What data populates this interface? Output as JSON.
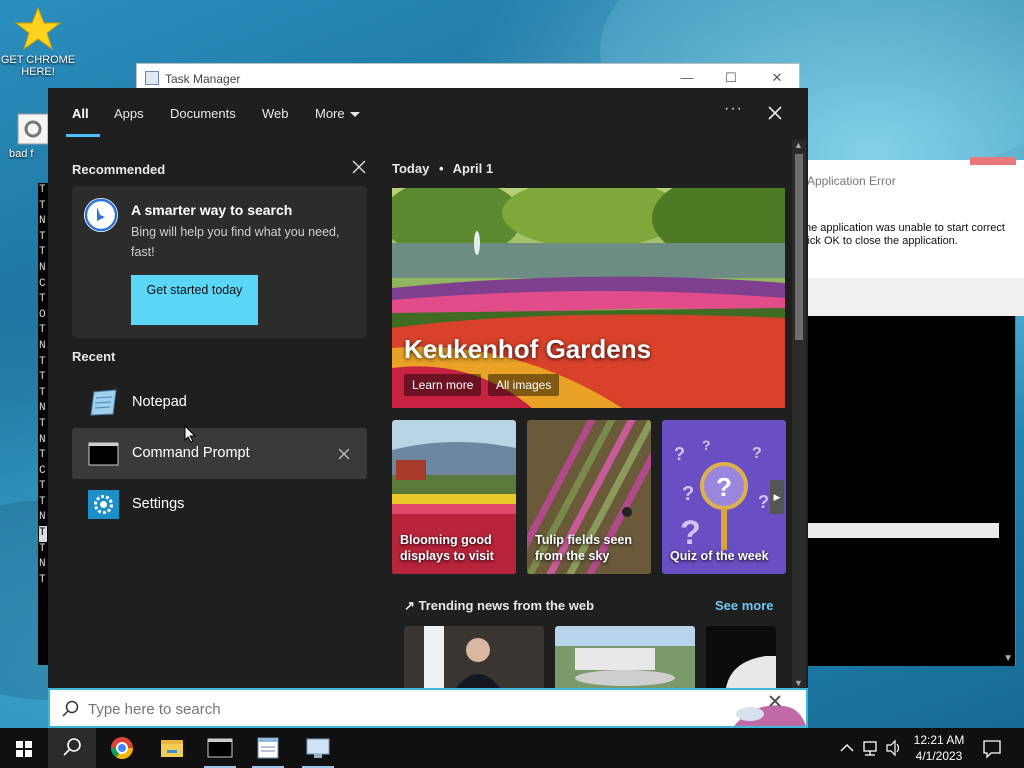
{
  "desktop": {
    "icons": [
      {
        "label": "GET CHROME HERE!",
        "icon": "star-icon"
      },
      {
        "label": "bad f",
        "icon": "settings-file-icon"
      }
    ]
  },
  "task_manager": {
    "title": "Task Manager",
    "controls": {
      "minimize": "—",
      "maximize": "☐",
      "close": "✕"
    }
  },
  "console_left": {
    "lines": [
      "T",
      "T",
      "N",
      "T",
      "T",
      "N",
      "C",
      "T",
      "O",
      "T",
      "N",
      "T",
      "T",
      "T",
      "N",
      "T",
      "N",
      "T",
      "C",
      "T",
      "T",
      "N",
      "T",
      "T",
      "N",
      "T"
    ]
  },
  "app_error": {
    "title": "Application Error",
    "message_line1": "he application was unable to start correct",
    "message_line2": "lick OK to close the application."
  },
  "search_panel": {
    "tabs": [
      {
        "label": "All",
        "active": true
      },
      {
        "label": "Apps"
      },
      {
        "label": "Documents"
      },
      {
        "label": "Web"
      },
      {
        "label": "More"
      }
    ],
    "ellipsis": "···",
    "recommended": {
      "title": "Recommended",
      "card_heading": "A smarter way to search",
      "card_body": "Bing will help you find what you need, fast!",
      "button": "Get started today"
    },
    "recent": {
      "title": "Recent",
      "items": [
        {
          "label": "Notepad",
          "icon": "notepad-icon"
        },
        {
          "label": "Command Prompt",
          "icon": "command-prompt-icon"
        },
        {
          "label": "Settings",
          "icon": "settings-gear-icon"
        }
      ]
    },
    "today": {
      "label": "Today",
      "separator": "•",
      "date": "April 1",
      "hero_title": "Keukenhof Gardens",
      "hero_links": [
        "Learn more",
        "All images"
      ],
      "tiles": [
        {
          "label": "Blooming good displays to visit"
        },
        {
          "label": "Tulip fields seen from the sky"
        },
        {
          "label": "Quiz of the week"
        }
      ],
      "trending_title": "Trending news from the web",
      "see_more": "See more"
    }
  },
  "searchbox": {
    "placeholder": "Type here to search"
  },
  "taskbar": {
    "apps": [
      "start-icon",
      "search-icon",
      "chrome-icon",
      "file-explorer-icon",
      "command-prompt-icon",
      "notepad-icon",
      "remote-desktop-icon"
    ],
    "clock_time": "12:21 AM",
    "clock_date": "4/1/2023"
  },
  "colors": {
    "panel_bg": "#1f1f1f",
    "accent": "#4cc2ff",
    "button_bg": "#5ad6f7",
    "see_more": "#6fc8f2"
  }
}
